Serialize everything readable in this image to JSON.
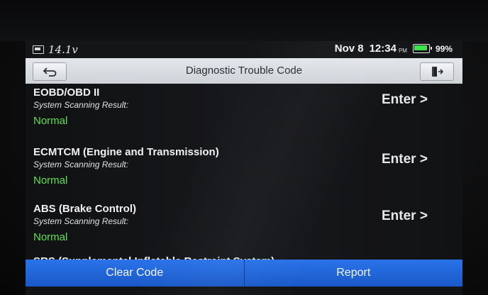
{
  "status_bar": {
    "voltage": "14.1v",
    "date": "Nov 8",
    "time": "12:34",
    "time_suffix": "PM",
    "battery": "99%",
    "battery_color": "#3fe04a"
  },
  "title_bar": {
    "back_icon": "back-arrow-icon",
    "title": "Diagnostic Trouble Code",
    "exit_icon": "exit-icon"
  },
  "systems": [
    {
      "name": "EOBD/OBD II",
      "subtitle": "System Scanning Result:",
      "result": "Normal",
      "action": "Enter >"
    },
    {
      "name": "ECMTCM (Engine and Transmission)",
      "subtitle": "System Scanning Result:",
      "result": "Normal",
      "action": "Enter >"
    },
    {
      "name": "ABS (Brake Control)",
      "subtitle": "System Scanning Result:",
      "result": "Normal",
      "action": "Enter >"
    }
  ],
  "partial_item": "SRS (Supplemental Inflatable Restraint System)",
  "colors": {
    "result_ok": "#5fe04e",
    "button_blue": "#1e64d8"
  },
  "buttons": {
    "clear_code": "Clear Code",
    "report": "Report"
  }
}
